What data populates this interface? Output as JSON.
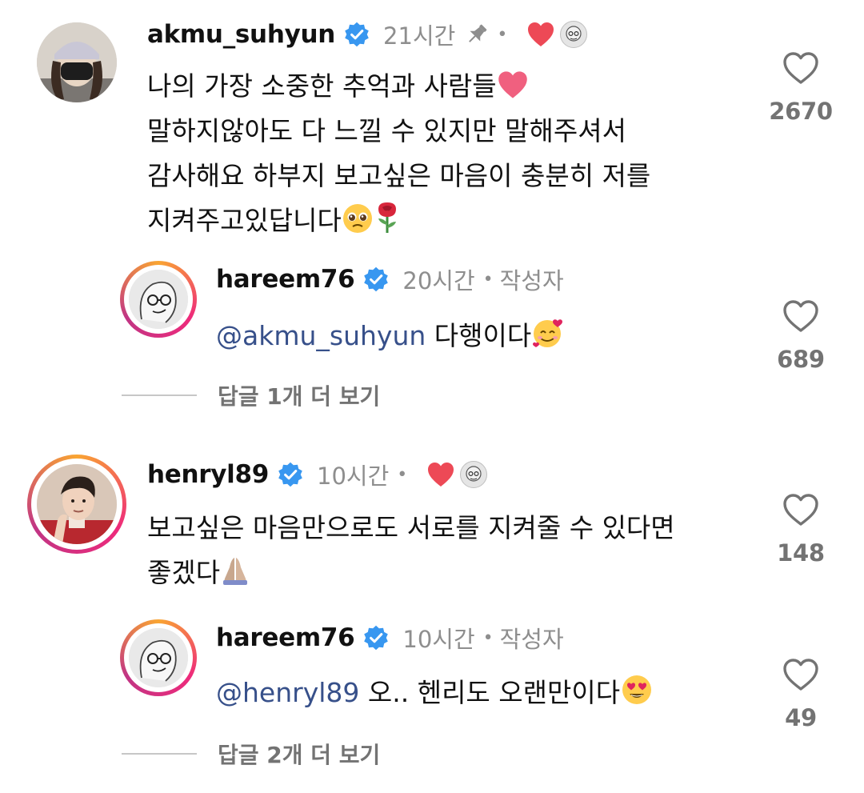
{
  "comments": [
    {
      "username": "akmu_suhyun",
      "time": "21시간",
      "lines": [
        "나의 가장 소중한 추억과 사람들",
        "말하지않아도 다 느낄 수 있지만 말해주셔서",
        "감사해요 하부지 보고싶은 마음이 충분히 저를",
        "지켜주고있답니다"
      ],
      "likes": "2670",
      "reply": {
        "username": "hareem76",
        "time": "20시간",
        "author_label": "작성자",
        "mention": "@akmu_suhyun",
        "text": " 다행이다",
        "likes": "689"
      },
      "more_replies": "답글 1개 더 보기"
    },
    {
      "username": "henryl89",
      "time": "10시간",
      "lines": [
        "보고싶은 마음만으로도 서로를 지켜줄 수 있다면",
        "좋겠다"
      ],
      "likes": "148",
      "reply": {
        "username": "hareem76",
        "time": "10시간",
        "author_label": "작성자",
        "mention": "@henryl89",
        "text": " 오.. 헨리도 오랜만이다",
        "likes": "49"
      },
      "more_replies": "답글 2개 더 보기"
    }
  ],
  "icons": {
    "verified": "verified-badge-icon",
    "pin": "pin-icon",
    "liked_by_creator": "red-heart-icon",
    "like": "heart-outline-icon"
  },
  "colors": {
    "verified_blue": "#3897f0",
    "heart_red": "#ed4956",
    "mention_blue": "#37508a",
    "meta_gray": "#8e8e8e"
  }
}
